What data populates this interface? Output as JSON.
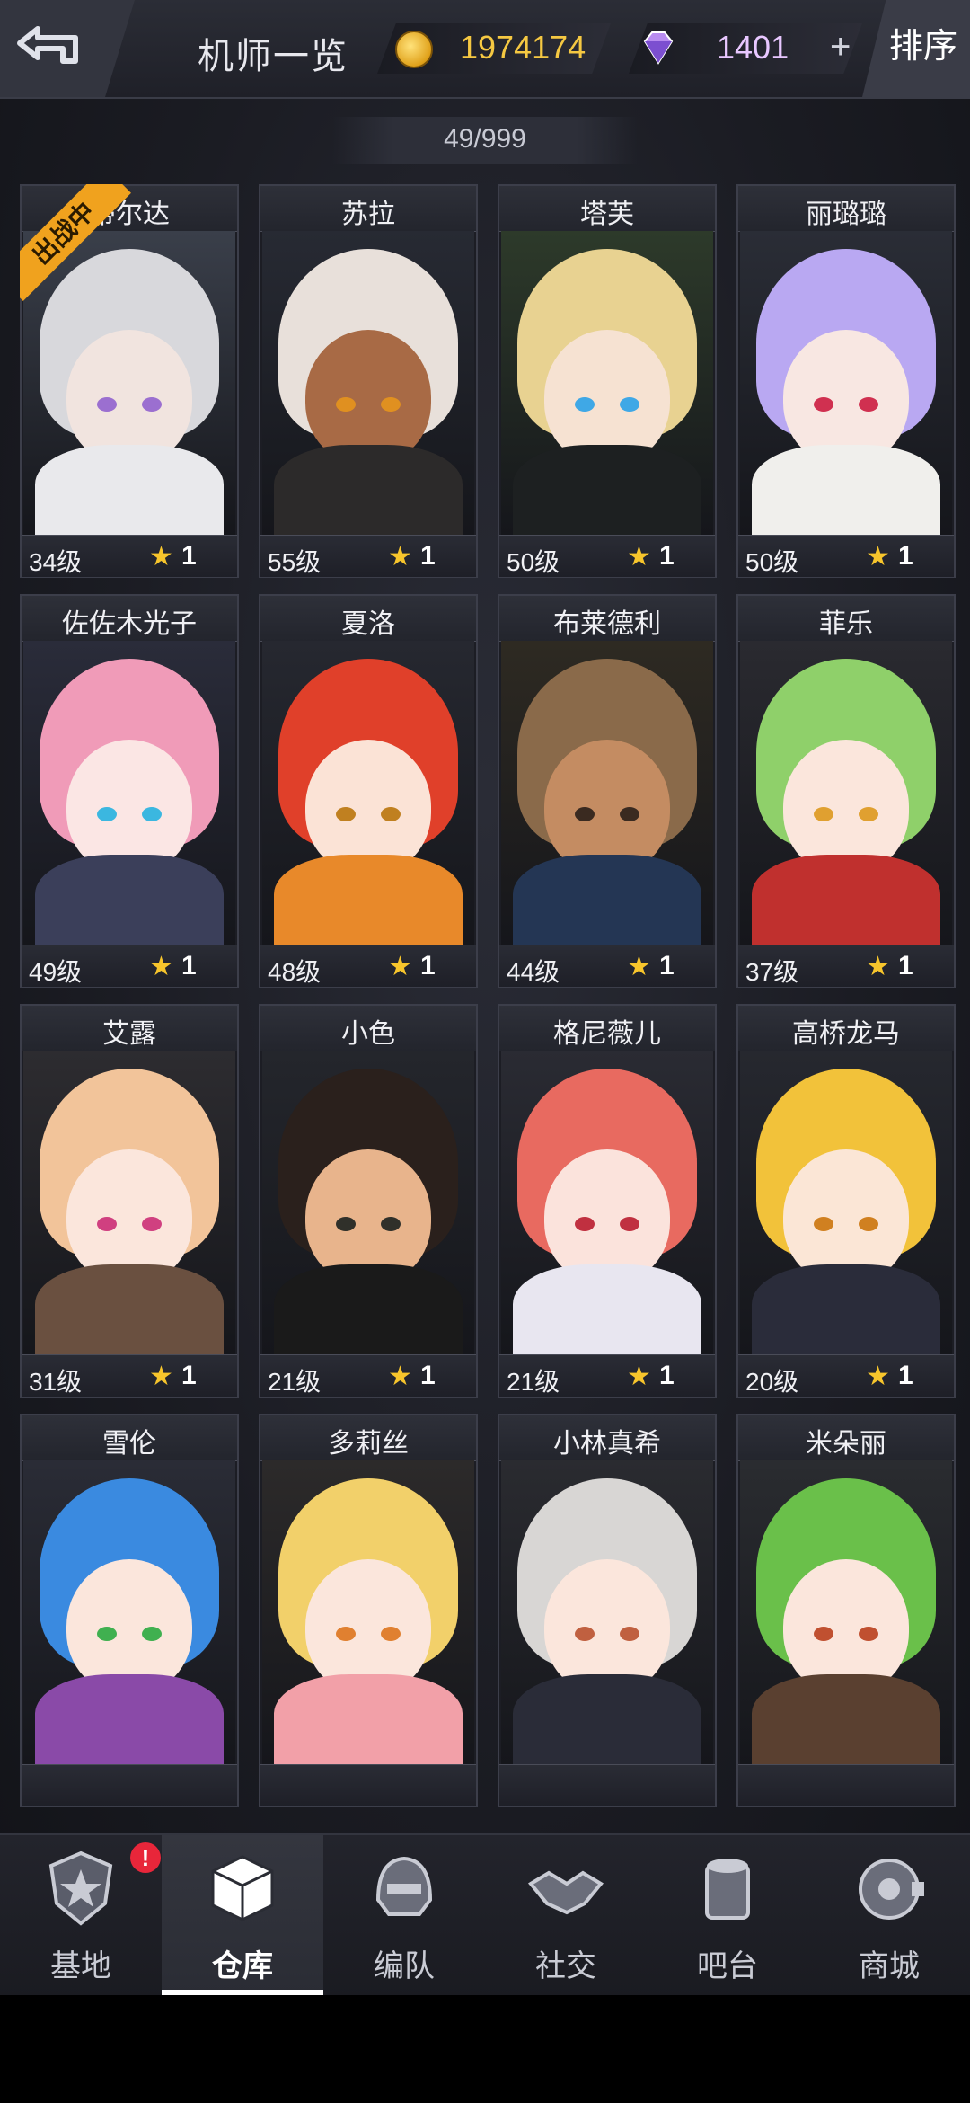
{
  "header": {
    "title": "机师一览",
    "coins": "1974174",
    "gems": "1401",
    "plus": "+",
    "sort_label": "排序",
    "count": "49/999"
  },
  "pilots": [
    {
      "name": "蒂尔达",
      "level": "34级",
      "stars": "1",
      "badge": "出战中",
      "hair": "#d8d8dc",
      "skin": "#f1e4df",
      "outfit": "#e9e9ec",
      "eye": "#9b6fd0",
      "bg": "#3a3f4a"
    },
    {
      "name": "苏拉",
      "level": "55级",
      "stars": "1",
      "hair": "#e8e0da",
      "skin": "#a86a45",
      "outfit": "#2c2a2a",
      "eye": "#e09020",
      "bg": "#272a33"
    },
    {
      "name": "塔芙",
      "level": "50级",
      "stars": "1",
      "hair": "#e8d291",
      "skin": "#f6e2d2",
      "outfit": "#1d2021",
      "eye": "#3fa8e6",
      "bg": "#2d3a2a"
    },
    {
      "name": "丽璐璐",
      "level": "50级",
      "stars": "1",
      "hair": "#b9a8f2",
      "skin": "#f8e7e2",
      "outfit": "#f0efec",
      "eye": "#d03050",
      "bg": "#2a2d36"
    },
    {
      "name": "佐佐木光子",
      "level": "49级",
      "stars": "1",
      "hair": "#f09bb8",
      "skin": "#fbe6e4",
      "outfit": "#3b3f5a",
      "eye": "#3bb7e0",
      "bg": "#2a2c3a"
    },
    {
      "name": "夏洛",
      "level": "48级",
      "stars": "1",
      "hair": "#e0402a",
      "skin": "#fbe3d6",
      "outfit": "#e8892a",
      "eye": "#c08020",
      "bg": "#262830"
    },
    {
      "name": "布莱德利",
      "level": "44级",
      "stars": "1",
      "hair": "#8a6a4a",
      "skin": "#c48c62",
      "outfit": "#243654",
      "eye": "#3a2a20",
      "bg": "#2e2a22"
    },
    {
      "name": "菲乐",
      "level": "37级",
      "stars": "1",
      "hair": "#8fd06a",
      "skin": "#fbe6dc",
      "outfit": "#c0302e",
      "eye": "#e0a030",
      "bg": "#2a2a30"
    },
    {
      "name": "艾露",
      "level": "31级",
      "stars": "1",
      "hair": "#f2c49a",
      "skin": "#fbe6dc",
      "outfit": "#6a5040",
      "eye": "#d04080",
      "bg": "#2d2c30"
    },
    {
      "name": "小色",
      "level": "21级",
      "stars": "1",
      "hair": "#2a201c",
      "skin": "#e8b48c",
      "outfit": "#1a1a1a",
      "eye": "#30302a",
      "bg": "#24262c"
    },
    {
      "name": "格尼薇儿",
      "level": "21级",
      "stars": "1",
      "hair": "#e86a60",
      "skin": "#fbe3dc",
      "outfit": "#e8e6f0",
      "eye": "#c03040",
      "bg": "#2a2b33"
    },
    {
      "name": "高桥龙马",
      "level": "20级",
      "stars": "1",
      "hair": "#f2c23a",
      "skin": "#fbe6d6",
      "outfit": "#2a2c3a",
      "eye": "#d08020",
      "bg": "#26282f"
    },
    {
      "name": "雪伦",
      "level": "",
      "stars": "",
      "hair": "#3a8ae0",
      "skin": "#fbe6dc",
      "outfit": "#8a4aa8",
      "eye": "#40b050",
      "bg": "#2a2c36"
    },
    {
      "name": "多莉丝",
      "level": "",
      "stars": "",
      "hair": "#f2d06a",
      "skin": "#fbe6dc",
      "outfit": "#f2a0a8",
      "eye": "#e08030",
      "bg": "#2c2a2a"
    },
    {
      "name": "小林真希",
      "level": "",
      "stars": "",
      "hair": "#d8d6d4",
      "skin": "#fbe6dc",
      "outfit": "#2a2c38",
      "eye": "#c06040",
      "bg": "#2a2b30"
    },
    {
      "name": "米朵丽",
      "level": "",
      "stars": "",
      "hair": "#6ac04a",
      "skin": "#fbe6dc",
      "outfit": "#5a4030",
      "eye": "#c05030",
      "bg": "#2a2c30"
    }
  ],
  "nav": [
    {
      "label": "基地",
      "icon": "star-shield-icon",
      "alert": "!"
    },
    {
      "label": "仓库",
      "icon": "cube-icon",
      "active": true
    },
    {
      "label": "编队",
      "icon": "helmet-icon"
    },
    {
      "label": "社交",
      "icon": "handshake-icon"
    },
    {
      "label": "吧台",
      "icon": "cup-icon"
    },
    {
      "label": "商城",
      "icon": "robot-icon"
    }
  ]
}
